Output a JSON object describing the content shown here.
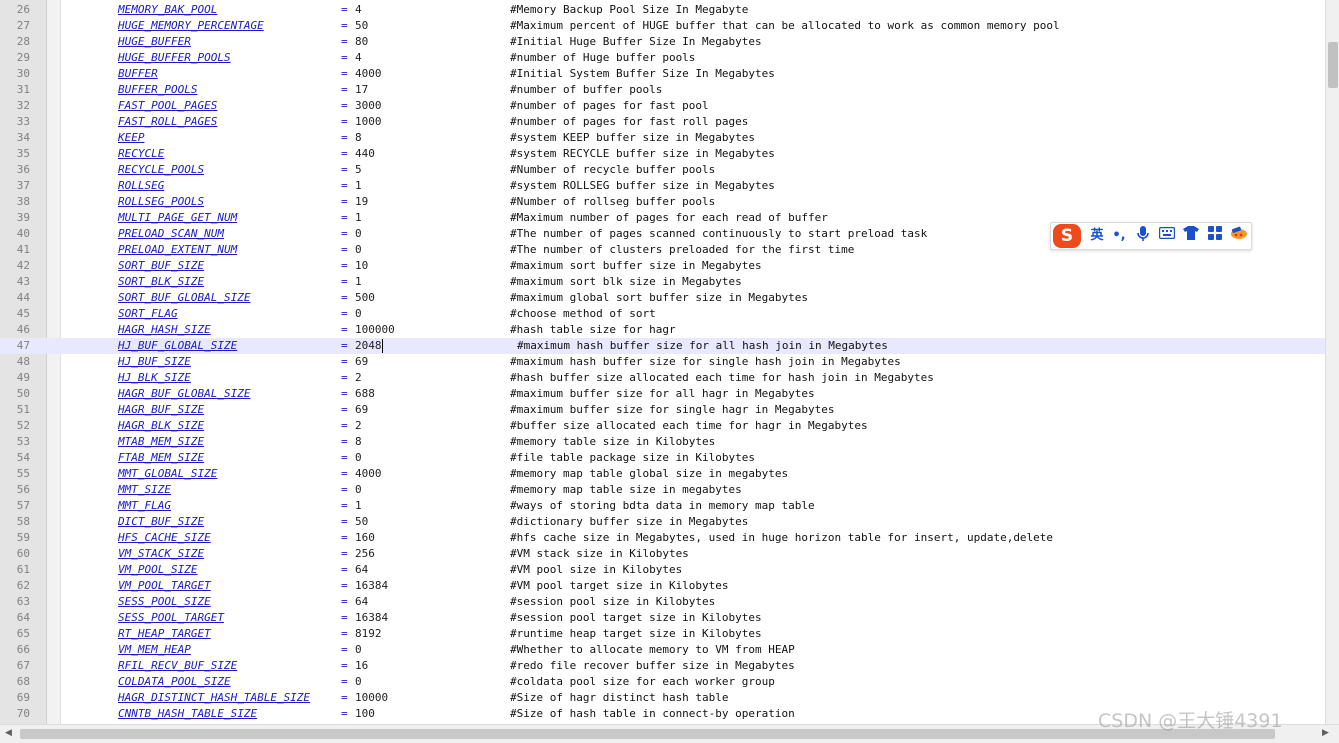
{
  "editor": {
    "current_line": "47",
    "lines": [
      {
        "num": "26",
        "key": "MEMORY_BAK_POOL",
        "eq": "=",
        "val": "4",
        "cmt": "#Memory Backup Pool Size In Megabyte"
      },
      {
        "num": "27",
        "key": "HUGE_MEMORY_PERCENTAGE",
        "eq": "=",
        "val": "50",
        "cmt": "#Maximum percent of HUGE buffer that can be allocated to work as common memory pool"
      },
      {
        "num": "28",
        "key": "HUGE_BUFFER",
        "eq": "=",
        "val": "80",
        "cmt": "#Initial Huge Buffer Size In Megabytes"
      },
      {
        "num": "29",
        "key": "HUGE_BUFFER_POOLS",
        "eq": "=",
        "val": "4",
        "cmt": "#number of Huge buffer pools"
      },
      {
        "num": "30",
        "key": "BUFFER",
        "eq": "=",
        "val": "4000",
        "cmt": "#Initial System Buffer Size In Megabytes"
      },
      {
        "num": "31",
        "key": "BUFFER_POOLS",
        "eq": "=",
        "val": "17",
        "cmt": "#number of buffer pools"
      },
      {
        "num": "32",
        "key": "FAST_POOL_PAGES",
        "eq": "=",
        "val": "3000",
        "cmt": "#number of pages for fast pool"
      },
      {
        "num": "33",
        "key": "FAST_ROLL_PAGES",
        "eq": "=",
        "val": "1000",
        "cmt": "#number of pages for fast roll pages"
      },
      {
        "num": "34",
        "key": "KEEP",
        "eq": "=",
        "val": "8",
        "cmt": "#system KEEP buffer size in Megabytes"
      },
      {
        "num": "35",
        "key": "RECYCLE",
        "eq": "=",
        "val": "440",
        "cmt": "#system RECYCLE buffer size in Megabytes"
      },
      {
        "num": "36",
        "key": "RECYCLE_POOLS",
        "eq": "=",
        "val": "5",
        "cmt": "#Number of recycle buffer pools"
      },
      {
        "num": "37",
        "key": "ROLLSEG",
        "eq": "=",
        "val": "1",
        "cmt": "#system ROLLSEG buffer size in Megabytes"
      },
      {
        "num": "38",
        "key": "ROLLSEG_POOLS",
        "eq": "=",
        "val": "19",
        "cmt": "#Number of rollseg buffer pools"
      },
      {
        "num": "39",
        "key": "MULTI_PAGE_GET_NUM",
        "eq": "=",
        "val": "1",
        "cmt": "#Maximum number of pages for each read of buffer"
      },
      {
        "num": "40",
        "key": "PRELOAD_SCAN_NUM",
        "eq": "=",
        "val": "0",
        "cmt": "#The number of pages scanned continuously to start preload task"
      },
      {
        "num": "41",
        "key": "PRELOAD_EXTENT_NUM",
        "eq": "=",
        "val": "0",
        "cmt": "#The number of clusters preloaded for the first time"
      },
      {
        "num": "42",
        "key": "SORT_BUF_SIZE",
        "eq": "=",
        "val": "10",
        "cmt": "#maximum sort buffer size in Megabytes"
      },
      {
        "num": "43",
        "key": "SORT_BLK_SIZE",
        "eq": "=",
        "val": "1",
        "cmt": "#maximum sort blk size in Megabytes"
      },
      {
        "num": "44",
        "key": "SORT_BUF_GLOBAL_SIZE",
        "eq": "=",
        "val": "500",
        "cmt": "#maximum global sort buffer size in Megabytes"
      },
      {
        "num": "45",
        "key": "SORT_FLAG",
        "eq": "=",
        "val": "0",
        "cmt": "#choose method of sort"
      },
      {
        "num": "46",
        "key": "HAGR_HASH_SIZE",
        "eq": "=",
        "val": "100000",
        "cmt": "#hash table size for hagr"
      },
      {
        "num": "47",
        "key": "HJ_BUF_GLOBAL_SIZE",
        "eq": "=",
        "val": "2048",
        "cmt": "#maximum hash buffer size for all hash join in Megabytes"
      },
      {
        "num": "48",
        "key": "HJ_BUF_SIZE",
        "eq": "=",
        "val": "69",
        "cmt": "#maximum hash buffer size for single hash join in Megabytes"
      },
      {
        "num": "49",
        "key": "HJ_BLK_SIZE",
        "eq": "=",
        "val": "2",
        "cmt": "#hash buffer size allocated each time for hash join in Megabytes"
      },
      {
        "num": "50",
        "key": "HAGR_BUF_GLOBAL_SIZE",
        "eq": "=",
        "val": "688",
        "cmt": "#maximum buffer size for all hagr in Megabytes"
      },
      {
        "num": "51",
        "key": "HAGR_BUF_SIZE",
        "eq": "=",
        "val": "69",
        "cmt": "#maximum buffer size for single hagr in Megabytes"
      },
      {
        "num": "52",
        "key": "HAGR_BLK_SIZE",
        "eq": "=",
        "val": "2",
        "cmt": "#buffer size allocated each time for hagr in Megabytes"
      },
      {
        "num": "53",
        "key": "MTAB_MEM_SIZE",
        "eq": "=",
        "val": "8",
        "cmt": "#memory table size in Kilobytes"
      },
      {
        "num": "54",
        "key": "FTAB_MEM_SIZE",
        "eq": "=",
        "val": "0",
        "cmt": "#file table package size in Kilobytes"
      },
      {
        "num": "55",
        "key": "MMT_GLOBAL_SIZE",
        "eq": "=",
        "val": "4000",
        "cmt": "#memory map table global size in megabytes"
      },
      {
        "num": "56",
        "key": "MMT_SIZE",
        "eq": "=",
        "val": "0",
        "cmt": "#memory map table size in megabytes"
      },
      {
        "num": "57",
        "key": "MMT_FLAG",
        "eq": "=",
        "val": "1",
        "cmt": "#ways of storing bdta data in memory map table"
      },
      {
        "num": "58",
        "key": "DICT_BUF_SIZE",
        "eq": "=",
        "val": "50",
        "cmt": "#dictionary buffer size in Megabytes"
      },
      {
        "num": "59",
        "key": "HFS_CACHE_SIZE",
        "eq": "=",
        "val": "160",
        "cmt": "#hfs cache size in Megabytes, used in huge horizon table for insert, update,delete"
      },
      {
        "num": "60",
        "key": "VM_STACK_SIZE",
        "eq": "=",
        "val": "256",
        "cmt": "#VM stack size in Kilobytes"
      },
      {
        "num": "61",
        "key": "VM_POOL_SIZE",
        "eq": "=",
        "val": "64",
        "cmt": "#VM pool size in Kilobytes"
      },
      {
        "num": "62",
        "key": "VM_POOL_TARGET",
        "eq": "=",
        "val": "16384",
        "cmt": "#VM pool target size in Kilobytes"
      },
      {
        "num": "63",
        "key": "SESS_POOL_SIZE",
        "eq": "=",
        "val": "64",
        "cmt": "#session pool size in Kilobytes"
      },
      {
        "num": "64",
        "key": "SESS_POOL_TARGET",
        "eq": "=",
        "val": "16384",
        "cmt": "#session pool target size in Kilobytes"
      },
      {
        "num": "65",
        "key": "RT_HEAP_TARGET",
        "eq": "=",
        "val": "8192",
        "cmt": "#runtime heap target size in Kilobytes"
      },
      {
        "num": "66",
        "key": "VM_MEM_HEAP",
        "eq": "=",
        "val": "0",
        "cmt": "#Whether to allocate memory to VM from HEAP"
      },
      {
        "num": "67",
        "key": "RFIL_RECV_BUF_SIZE",
        "eq": "=",
        "val": "16",
        "cmt": "#redo file recover buffer size in Megabytes"
      },
      {
        "num": "68",
        "key": "COLDATA_POOL_SIZE",
        "eq": "=",
        "val": "0",
        "cmt": "#coldata pool size for each worker group"
      },
      {
        "num": "69",
        "key": "HAGR_DISTINCT_HASH_TABLE_SIZE",
        "eq": "=",
        "val": "10000",
        "cmt": "#Size of hagr distinct hash table"
      },
      {
        "num": "70",
        "key": "CNNTB_HASH_TABLE_SIZE",
        "eq": "=",
        "val": "100",
        "cmt": "#Size of hash table in connect-by operation"
      }
    ]
  },
  "ime_toolbar": {
    "logo": "S",
    "lang": "英",
    "punct": "•,",
    "buttons": [
      "mic-icon",
      "keyboard-icon",
      "skin-icon",
      "apps-icon",
      "tools-icon"
    ]
  },
  "watermark": "CSDN @王大锤4391"
}
